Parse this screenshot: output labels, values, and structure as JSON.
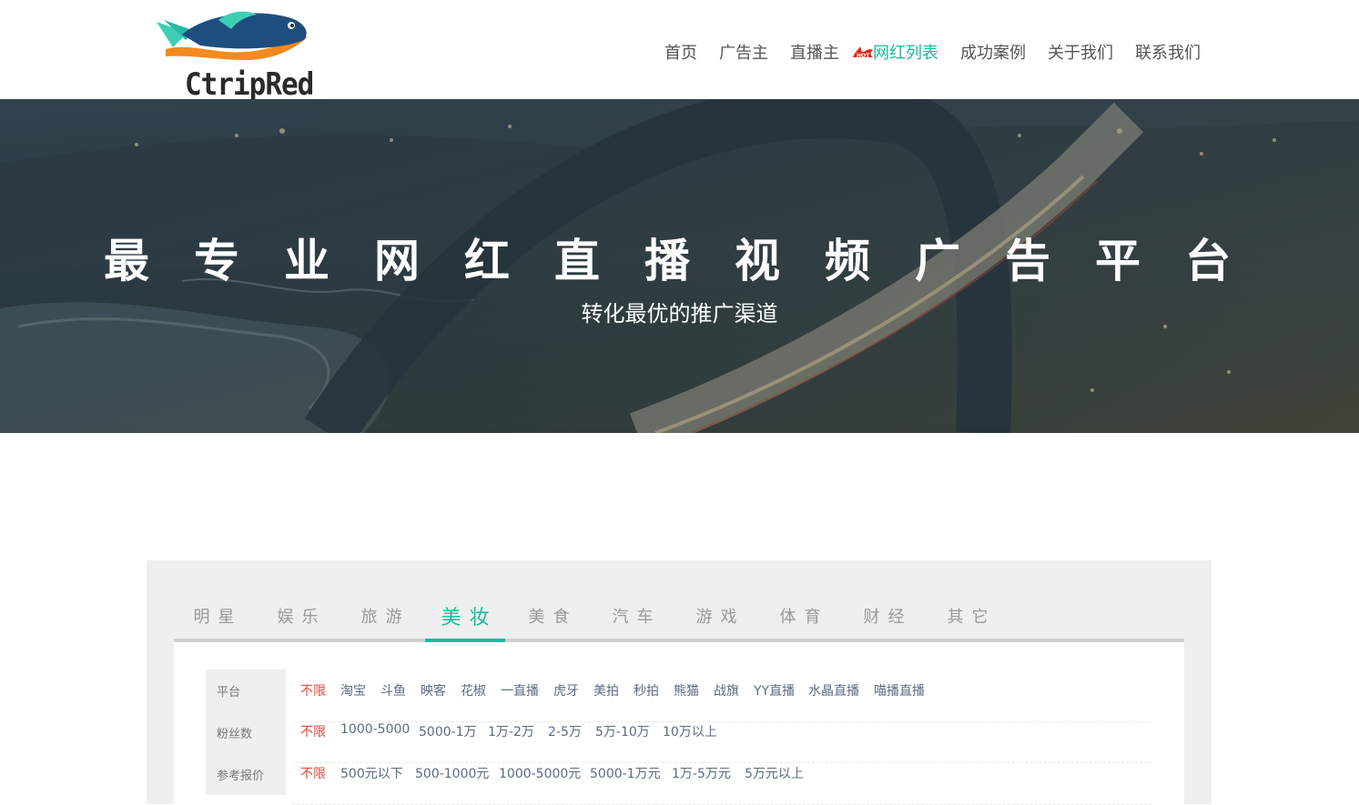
{
  "header": {
    "logo_text": "CtripRed",
    "nav": [
      {
        "label": "首页",
        "active": false
      },
      {
        "label": "广告主",
        "active": false
      },
      {
        "label": "直播主",
        "active": false
      },
      {
        "label": "网红列表",
        "active": true,
        "badge": "HOT"
      },
      {
        "label": "成功案例",
        "active": false
      },
      {
        "label": "关于我们",
        "active": false
      },
      {
        "label": "联系我们",
        "active": false
      }
    ]
  },
  "banner": {
    "title": "最专业网红直播视频广告平台",
    "subtitle": "转化最优的推广渠道"
  },
  "categories": {
    "tabs": [
      "明星",
      "娱乐",
      "旅游",
      "美妆",
      "美食",
      "汽车",
      "游戏",
      "体育",
      "财经",
      "其它"
    ],
    "active": "美妆"
  },
  "filters": {
    "platform": {
      "label": "平台",
      "options": [
        "不限",
        "淘宝",
        "斗鱼",
        "映客",
        "花椒",
        "一直播",
        "虎牙",
        "美拍",
        "秒拍",
        "熊猫",
        "战旗",
        "YY直播",
        "水晶直播",
        "喵播直播"
      ]
    },
    "fans": {
      "label": "粉丝数",
      "options": [
        "不限",
        "1000-5000",
        "5000-1万",
        "1万-2万",
        "2-5万",
        "5万-10万",
        "10万以上"
      ]
    },
    "price": {
      "label": "参考报价",
      "options": [
        "不限",
        "500元以下",
        "500-1000元",
        "1000-5000元",
        "5000-1万元",
        "1万-5万元",
        "5万元以上"
      ]
    }
  },
  "colors": {
    "accent": "#1abc9c",
    "selected": "#e74c3c",
    "nav_text": "#555555",
    "option_text": "#5b6b86"
  }
}
